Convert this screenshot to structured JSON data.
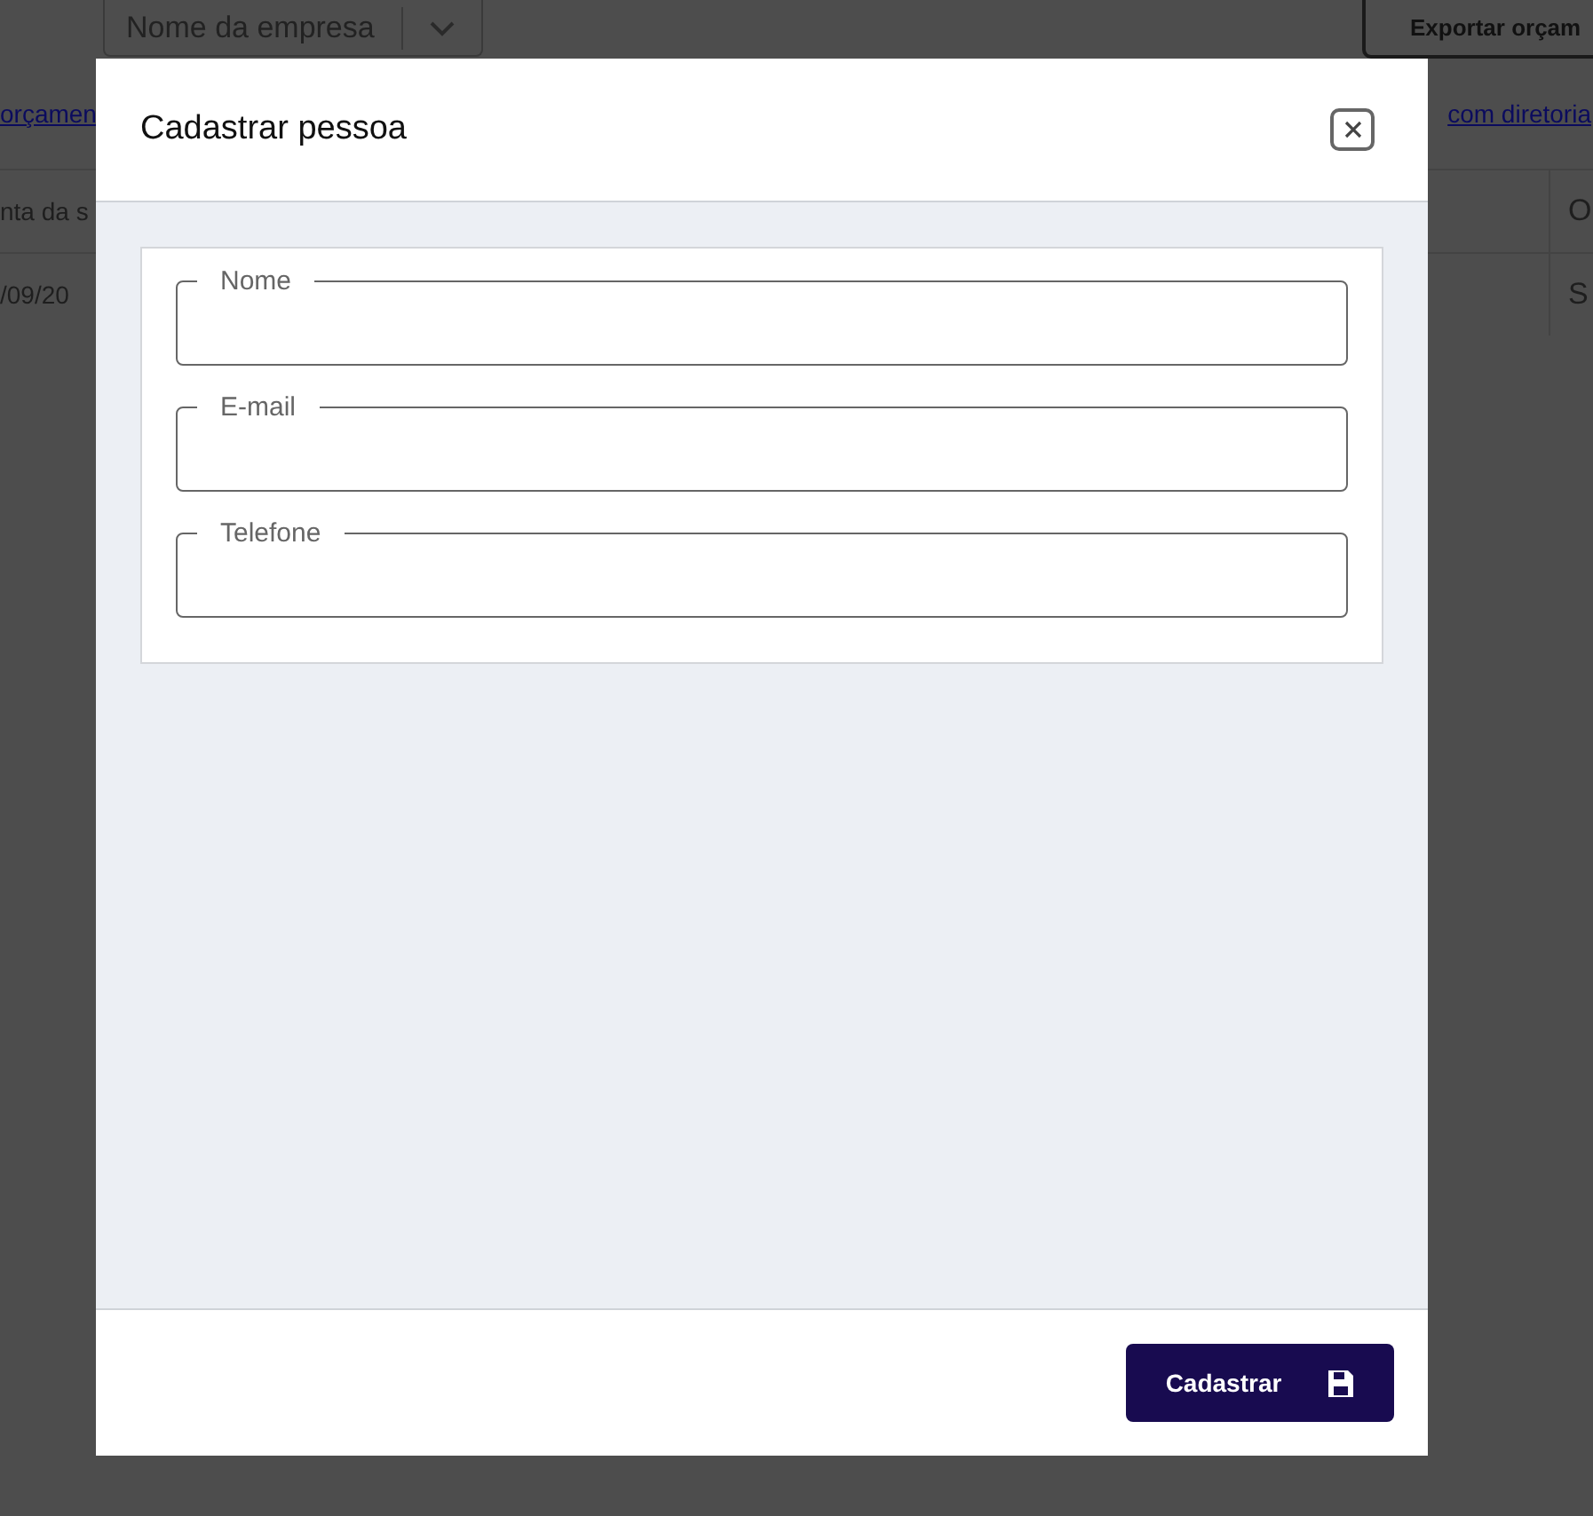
{
  "background": {
    "company_select": {
      "value": "Nome da empresa"
    },
    "export_button": "Exportar orçam",
    "links": [
      "orçamen",
      "com diretoria"
    ],
    "table": {
      "columns": [
        "nta da s",
        "O"
      ],
      "rows": [
        [
          "/09/20",
          "S"
        ]
      ]
    }
  },
  "dialog": {
    "title": "Cadastrar pessoa",
    "fields": [
      {
        "label": "Nome"
      },
      {
        "label": "E-mail"
      },
      {
        "label": "Telefone"
      }
    ],
    "submit_button": "Cadastrar"
  }
}
